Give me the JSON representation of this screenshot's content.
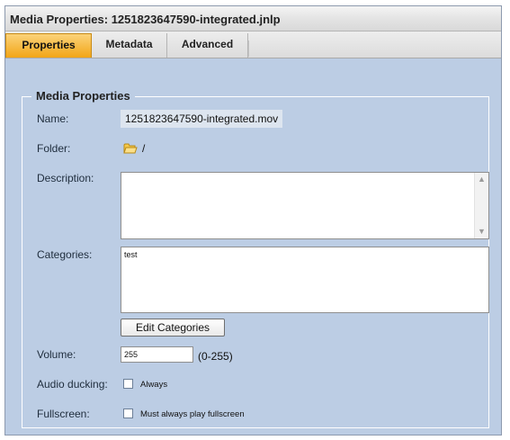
{
  "window": {
    "title": "Media Properties: 1251823647590-integrated.jnlp"
  },
  "tabs": [
    {
      "label": "Properties",
      "active": true
    },
    {
      "label": "Metadata",
      "active": false
    },
    {
      "label": "Advanced",
      "active": false
    }
  ],
  "section": {
    "legend": "Media Properties"
  },
  "fields": {
    "name_label": "Name:",
    "name_value": "1251823647590-integrated.mov",
    "folder_label": "Folder:",
    "folder_value": "/",
    "description_label": "Description:",
    "description_value": "",
    "categories_label": "Categories:",
    "categories_value": "test",
    "edit_categories_label": "Edit Categories",
    "volume_label": "Volume:",
    "volume_value": "255",
    "volume_range": "(0-255)",
    "audio_ducking_label": "Audio ducking:",
    "audio_ducking_option": "Always",
    "audio_ducking_checked": false,
    "fullscreen_label": "Fullscreen:",
    "fullscreen_option": "Must always play fullscreen",
    "fullscreen_checked": false
  },
  "icons": {
    "folder": "folder-icon",
    "scroll_up": "scroll-up-arrow-icon",
    "scroll_down": "scroll-down-arrow-icon"
  },
  "colors": {
    "panel_background": "#bccde4",
    "active_tab": "#f2a516"
  }
}
